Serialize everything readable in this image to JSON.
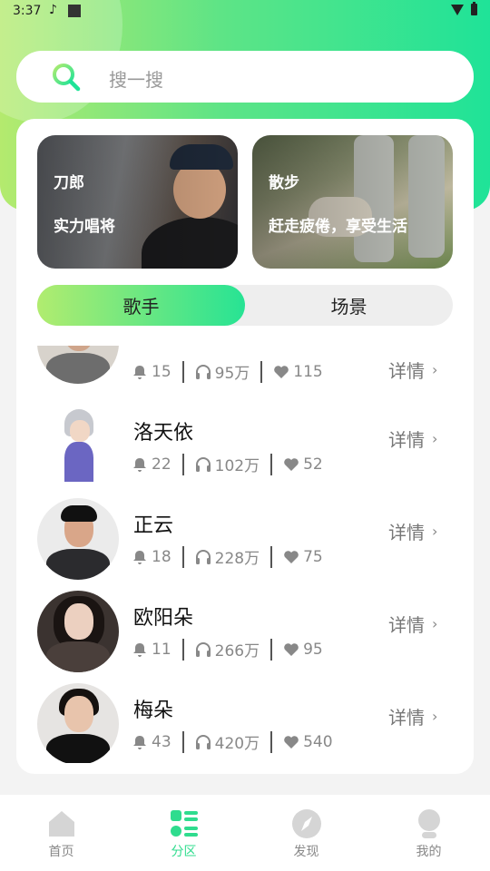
{
  "status_bar": {
    "time": "3:37"
  },
  "search": {
    "placeholder": "搜一搜"
  },
  "banners": [
    {
      "title": "刀郎",
      "subtitle": "实力唱将"
    },
    {
      "title": "散步",
      "subtitle": "赶走疲倦，享受生活"
    }
  ],
  "segments": {
    "active": "歌手",
    "other": "场景"
  },
  "singers": [
    {
      "name": "",
      "bell": "15",
      "listen": "95万",
      "like": "115",
      "detail": "详情"
    },
    {
      "name": "洛天依",
      "bell": "22",
      "listen": "102万",
      "like": "52",
      "detail": "详情"
    },
    {
      "name": "正云",
      "bell": "18",
      "listen": "228万",
      "like": "75",
      "detail": "详情"
    },
    {
      "name": "欧阳朵",
      "bell": "11",
      "listen": "266万",
      "like": "95",
      "detail": "详情"
    },
    {
      "name": "梅朵",
      "bell": "43",
      "listen": "420万",
      "like": "540",
      "detail": "详情"
    }
  ],
  "tabbar": [
    {
      "label": "首页",
      "icon": "home-icon"
    },
    {
      "label": "分区",
      "icon": "category-icon"
    },
    {
      "label": "发现",
      "icon": "compass-icon"
    },
    {
      "label": "我的",
      "icon": "profile-icon"
    }
  ],
  "colors": {
    "accent": "#2fdc8e",
    "gradient_start": "#b4ea6e",
    "gradient_end": "#1fe398"
  }
}
